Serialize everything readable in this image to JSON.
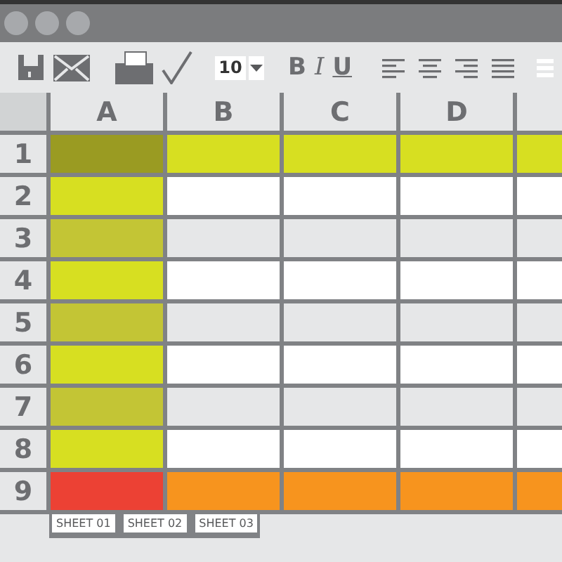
{
  "toolbar": {
    "font_size": "10",
    "format_buttons": [
      {
        "label": "B",
        "kind": "bold"
      },
      {
        "label": "I",
        "kind": "italic"
      },
      {
        "label": "U",
        "kind": "underline"
      }
    ]
  },
  "sheet": {
    "columns": [
      "A",
      "B",
      "C",
      "D"
    ],
    "rows": [
      {
        "header": "1",
        "cells": [
          {
            "color": "#9a9b22"
          },
          {
            "color": "#d7df21"
          },
          {
            "color": "#d7df21"
          },
          {
            "color": "#d7df21"
          },
          {
            "color": "#d7df21"
          }
        ]
      },
      {
        "header": "2",
        "cells": [
          {
            "color": "#d7df21"
          },
          {
            "color": "#ffffff"
          },
          {
            "color": "#ffffff"
          },
          {
            "color": "#ffffff"
          },
          {
            "color": "#ffffff"
          }
        ]
      },
      {
        "header": "3",
        "cells": [
          {
            "color": "#c3c535"
          },
          {
            "color": "#e6e7e8"
          },
          {
            "color": "#e6e7e8"
          },
          {
            "color": "#e6e7e8"
          },
          {
            "color": "#e6e7e8"
          }
        ]
      },
      {
        "header": "4",
        "cells": [
          {
            "color": "#d7df21"
          },
          {
            "color": "#ffffff"
          },
          {
            "color": "#ffffff"
          },
          {
            "color": "#ffffff"
          },
          {
            "color": "#ffffff"
          }
        ]
      },
      {
        "header": "5",
        "cells": [
          {
            "color": "#c3c535"
          },
          {
            "color": "#e6e7e8"
          },
          {
            "color": "#e6e7e8"
          },
          {
            "color": "#e6e7e8"
          },
          {
            "color": "#e6e7e8"
          }
        ]
      },
      {
        "header": "6",
        "cells": [
          {
            "color": "#d7df21"
          },
          {
            "color": "#ffffff"
          },
          {
            "color": "#ffffff"
          },
          {
            "color": "#ffffff"
          },
          {
            "color": "#ffffff"
          }
        ]
      },
      {
        "header": "7",
        "cells": [
          {
            "color": "#c3c535"
          },
          {
            "color": "#e6e7e8"
          },
          {
            "color": "#e6e7e8"
          },
          {
            "color": "#e6e7e8"
          },
          {
            "color": "#e6e7e8"
          }
        ]
      },
      {
        "header": "8",
        "cells": [
          {
            "color": "#d7df21"
          },
          {
            "color": "#ffffff"
          },
          {
            "color": "#ffffff"
          },
          {
            "color": "#ffffff"
          },
          {
            "color": "#ffffff"
          }
        ]
      },
      {
        "header": "9",
        "cells": [
          {
            "color": "#ec4134"
          },
          {
            "color": "#f7941e"
          },
          {
            "color": "#f7941e"
          },
          {
            "color": "#f7941e"
          },
          {
            "color": "#f7941e"
          }
        ]
      }
    ]
  },
  "sheet_tabs": [
    "SHEET 01",
    "SHEET 02",
    "SHEET 03"
  ]
}
